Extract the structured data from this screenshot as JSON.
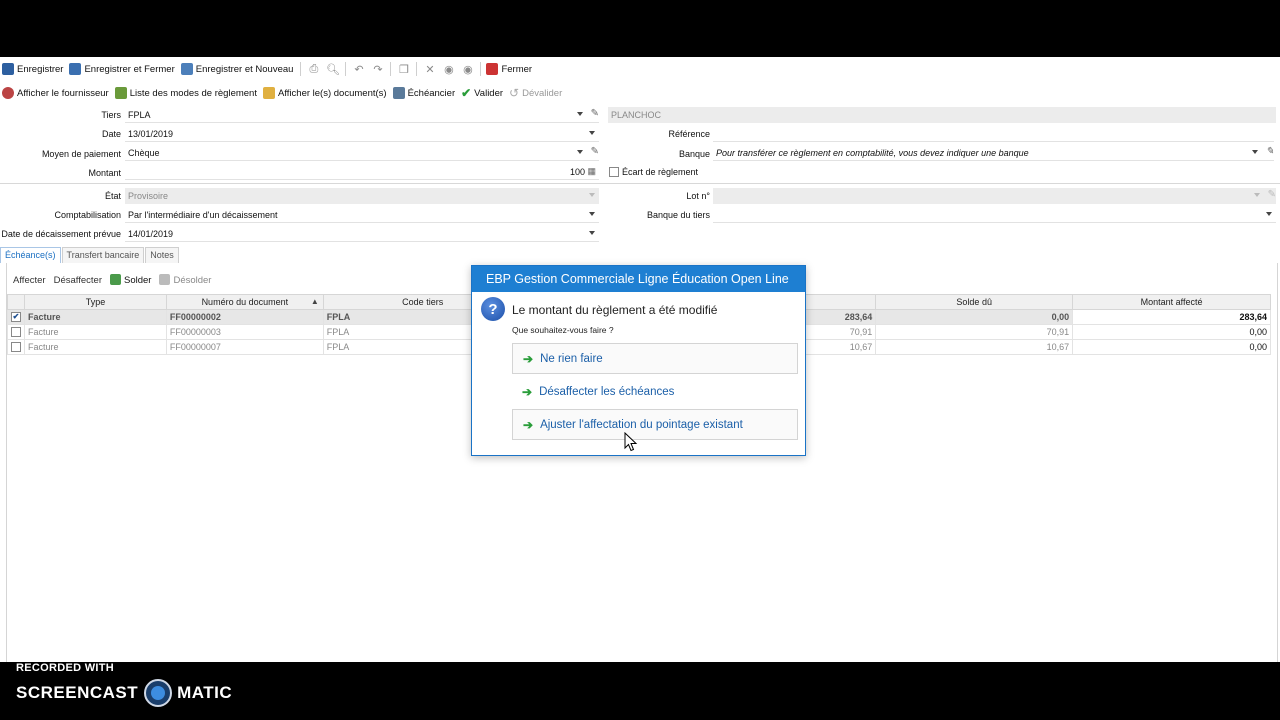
{
  "toolbar1": {
    "save": "Enregistrer",
    "save_close": "Enregistrer et Fermer",
    "save_new": "Enregistrer et Nouveau",
    "close": "Fermer"
  },
  "toolbar2": {
    "show_supplier": "Afficher le fournisseur",
    "payment_modes": "Liste des modes de règlement",
    "show_documents": "Afficher le(s) document(s)",
    "schedule": "Échéancier",
    "validate": "Valider",
    "unvalidate": "Dévalider"
  },
  "form": {
    "tiers_label": "Tiers",
    "tiers_value": "FPLA",
    "tiers_name": "PLANCHOC",
    "date_label": "Date",
    "date_value": "13/01/2019",
    "payment_means_label": "Moyen de paiement",
    "payment_means_value": "Chèque",
    "amount_label": "Montant",
    "amount_value": "100",
    "reference_label": "Référence",
    "reference_value": "",
    "bank_label": "Banque",
    "bank_value": "Pour transférer ce règlement en comptabilité, vous devez indiquer une banque",
    "gap_label": "Écart de règlement",
    "state_label": "État",
    "state_value": "Provisoire",
    "accounting_label": "Comptabilisation",
    "accounting_value": "Par l'intermédiaire d'un décaissement",
    "disbursement_date_label": "Date de décaissement prévue",
    "disbursement_date_value": "14/01/2019",
    "lot_label": "Lot n°",
    "lot_value": "",
    "tiers_bank_label": "Banque du tiers",
    "tiers_bank_value": ""
  },
  "tabs": [
    {
      "label": "Échéance(s)",
      "active": true
    },
    {
      "label": "Transfert bancaire",
      "active": false
    },
    {
      "label": "Notes",
      "active": false
    }
  ],
  "subtoolbar": {
    "assign": "Affecter",
    "unassign": "Désaffecter",
    "settle": "Solder",
    "unsettle": "Désolder"
  },
  "grid": {
    "columns": [
      "",
      "Type",
      "Numéro du document",
      "Code tiers",
      "",
      "Solde dû",
      "Montant affecté"
    ],
    "rows": [
      {
        "checked": true,
        "type": "Facture",
        "number": "FF00000002",
        "code": "FPLA",
        "amount": "283,64",
        "due": "0,00",
        "assigned": "283,64"
      },
      {
        "checked": false,
        "type": "Facture",
        "number": "FF00000003",
        "code": "FPLA",
        "amount": "70,91",
        "due": "70,91",
        "assigned": "0,00"
      },
      {
        "checked": false,
        "type": "Facture",
        "number": "FF00000007",
        "code": "FPLA",
        "amount": "10,67",
        "due": "10,67",
        "assigned": "0,00"
      }
    ]
  },
  "dialog": {
    "title": "EBP Gestion Commerciale Ligne Éducation Open Line",
    "message": "Le montant du règlement a été modifié",
    "question": "Que souhaitez-vous faire ?",
    "options": [
      "Ne rien faire",
      "Désaffecter les échéances",
      "Ajuster l'affectation du pointage existant"
    ]
  },
  "watermark": {
    "top": "RECORDED WITH",
    "left": "SCREENCAST",
    "right": "MATIC"
  },
  "colors": {
    "dialog_title_bg": "#1e7fd2",
    "link_text": "#1b5fa8",
    "arrow": "#2a9d3a",
    "active_tab": "#1a6fc2"
  }
}
